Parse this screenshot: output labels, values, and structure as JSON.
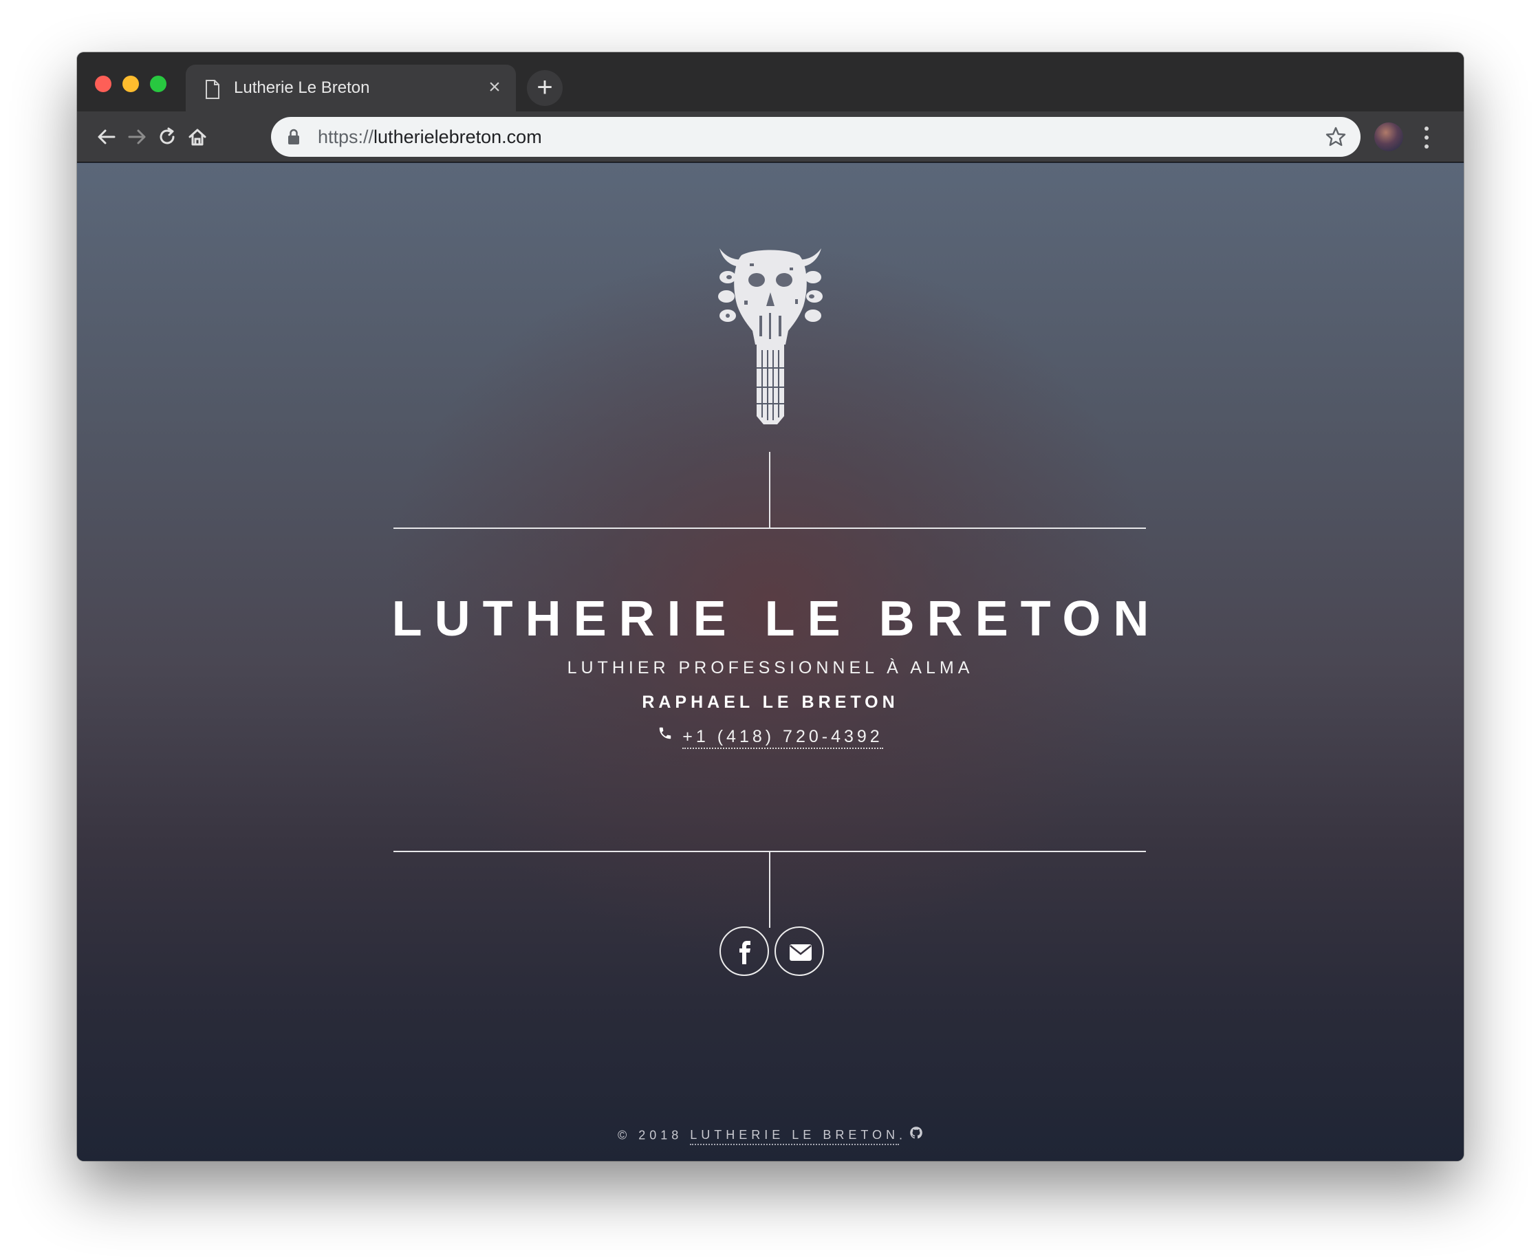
{
  "browser": {
    "tab_title": "Lutherie Le Breton",
    "url_scheme": "https://",
    "url_host": "lutherielebreton.com"
  },
  "page": {
    "title": "LUTHERIE LE BRETON",
    "subtitle": "LUTHIER PROFESSIONNEL À ALMA",
    "owner": "RAPHAEL LE BRETON",
    "phone": "+1 (418) 720-4392",
    "footer_prefix": "© 2018 ",
    "footer_brand": "LUTHERIE LE BRETON",
    "footer_suffix": "."
  },
  "icons": {
    "logo": "guitar-headstock-skull",
    "phone": "phone-icon",
    "facebook": "facebook-icon",
    "email": "envelope-icon",
    "github": "github-icon"
  },
  "colors": {
    "traffic_red": "#fe5f57",
    "traffic_yellow": "#febc2e",
    "traffic_green": "#28c840",
    "page_top": "#5b6779",
    "page_bottom": "#1f2535",
    "text": "#ffffff"
  }
}
